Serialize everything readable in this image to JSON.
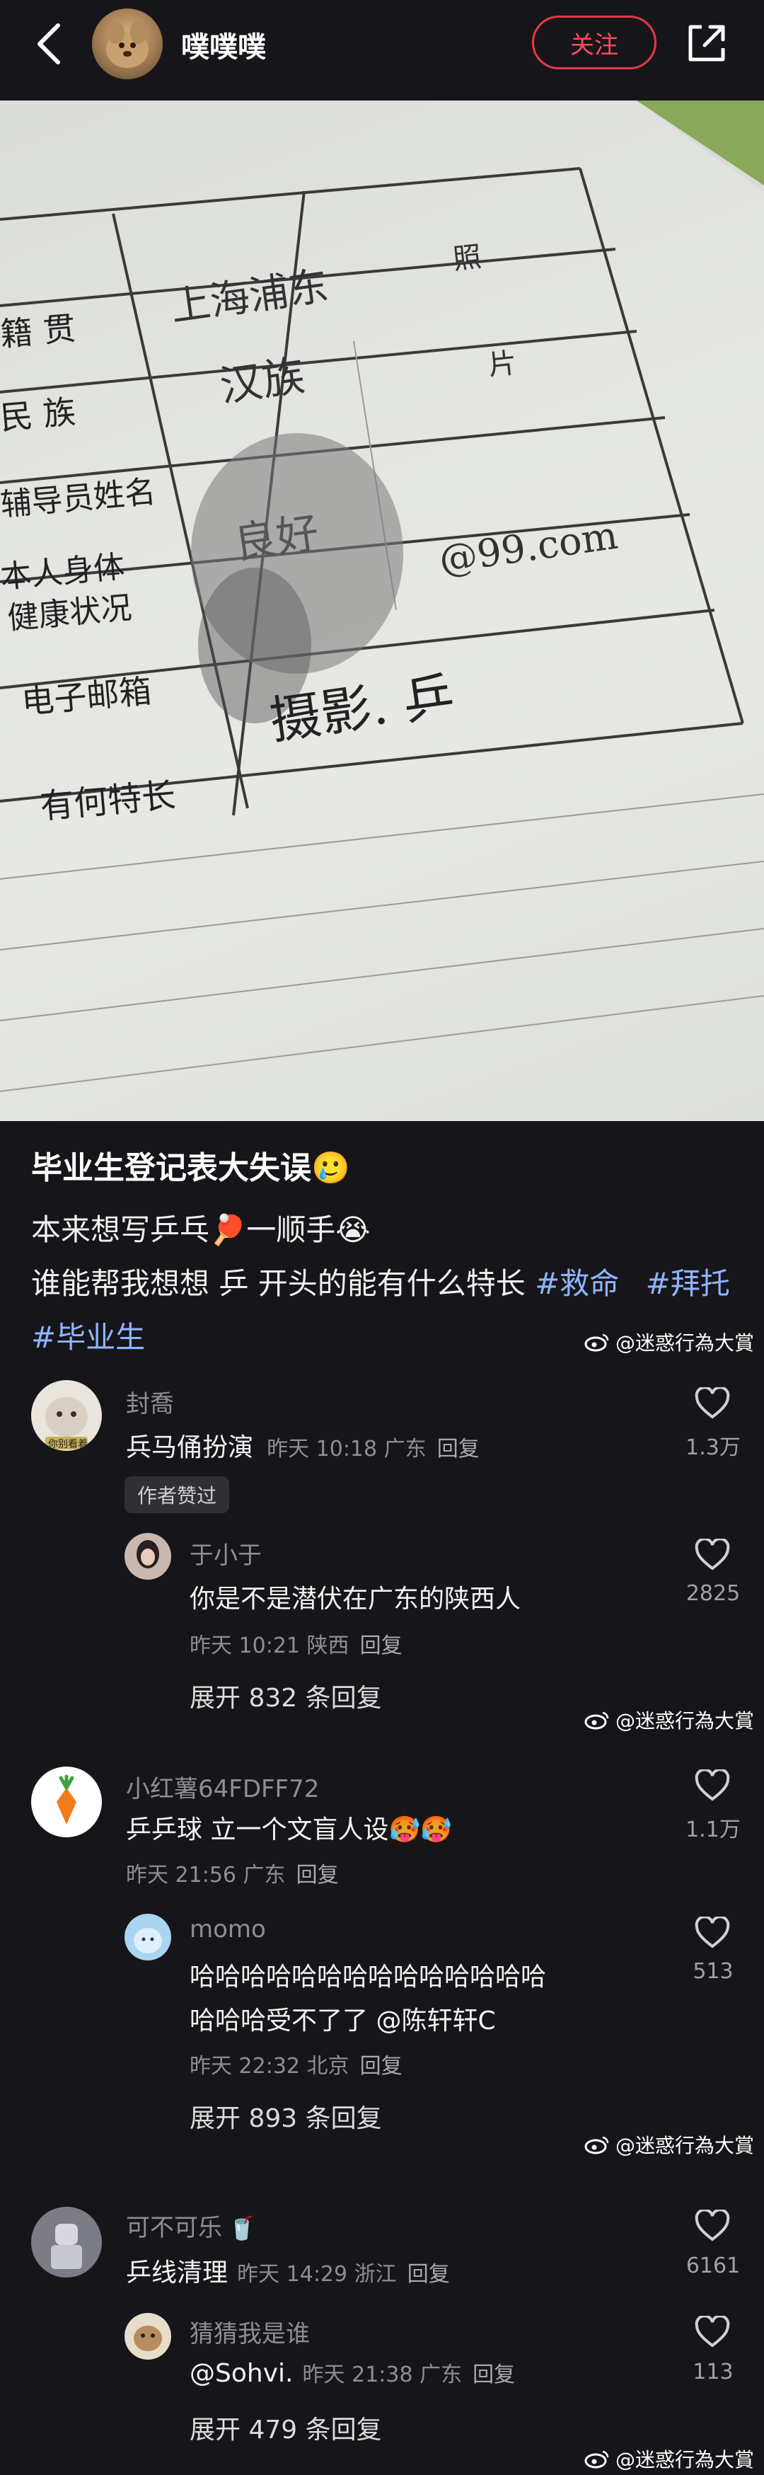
{
  "header": {
    "username": "噗噗噗",
    "follow_label": "关注"
  },
  "photo": {
    "row_labels": [
      "籍 贯",
      "民 族",
      "辅导员姓名",
      "本人身体",
      "健康状况",
      "电子邮箱",
      "有何特长"
    ],
    "values": [
      "上海浦东",
      "汉族",
      "良好",
      "@99.com",
      "摄影. 乒"
    ],
    "photo_box": [
      "照",
      "片"
    ]
  },
  "post": {
    "title": "毕业生登记表大失误",
    "line1": "本来想写乒乓",
    "line1b": "一顺手",
    "line2": "谁能帮我想想 乒 开头的能有什么特长",
    "tag1": "#救命",
    "tag2": "#拜托",
    "tag3": "#毕业生"
  },
  "watermark": "@迷惑行為大賞",
  "comments": [
    {
      "name": "封喬",
      "avatar_text": "你别看着",
      "text": "兵马俑扮演",
      "time": "昨天 10:18 广东",
      "reply": "回复",
      "likes": "1.3万",
      "badge": "作者赞过",
      "sub": {
        "name": "于小于",
        "text": "你是不是潜伏在广东的陕西人",
        "time": "昨天 10:21 陕西",
        "reply": "回复",
        "likes": "2825"
      },
      "expand": "展开 832 条回复"
    },
    {
      "name": "小红薯64FDFF72",
      "text": "乒乒球 立一个文盲人设",
      "time": "昨天 21:56 广东",
      "reply": "回复",
      "likes": "1.1万",
      "sub": {
        "name": "momo",
        "text1": "哈哈哈哈哈哈哈哈哈哈哈哈哈哈",
        "text2": "哈哈哈受不了了 @陈轩轩C",
        "time": "昨天 22:32 北京",
        "reply": "回复",
        "likes": "513"
      },
      "expand": "展开 893 条回复"
    },
    {
      "name": "可不可乐",
      "text": "乒线清理",
      "time": "昨天 14:29 浙江",
      "reply": "回复",
      "likes": "6161",
      "sub": {
        "name": "猜猜我是谁",
        "text": "@Sohvi.",
        "time": "昨天 21:38 广东",
        "reply": "回复",
        "likes": "113"
      },
      "expand": "展开 479 条回复"
    }
  ]
}
